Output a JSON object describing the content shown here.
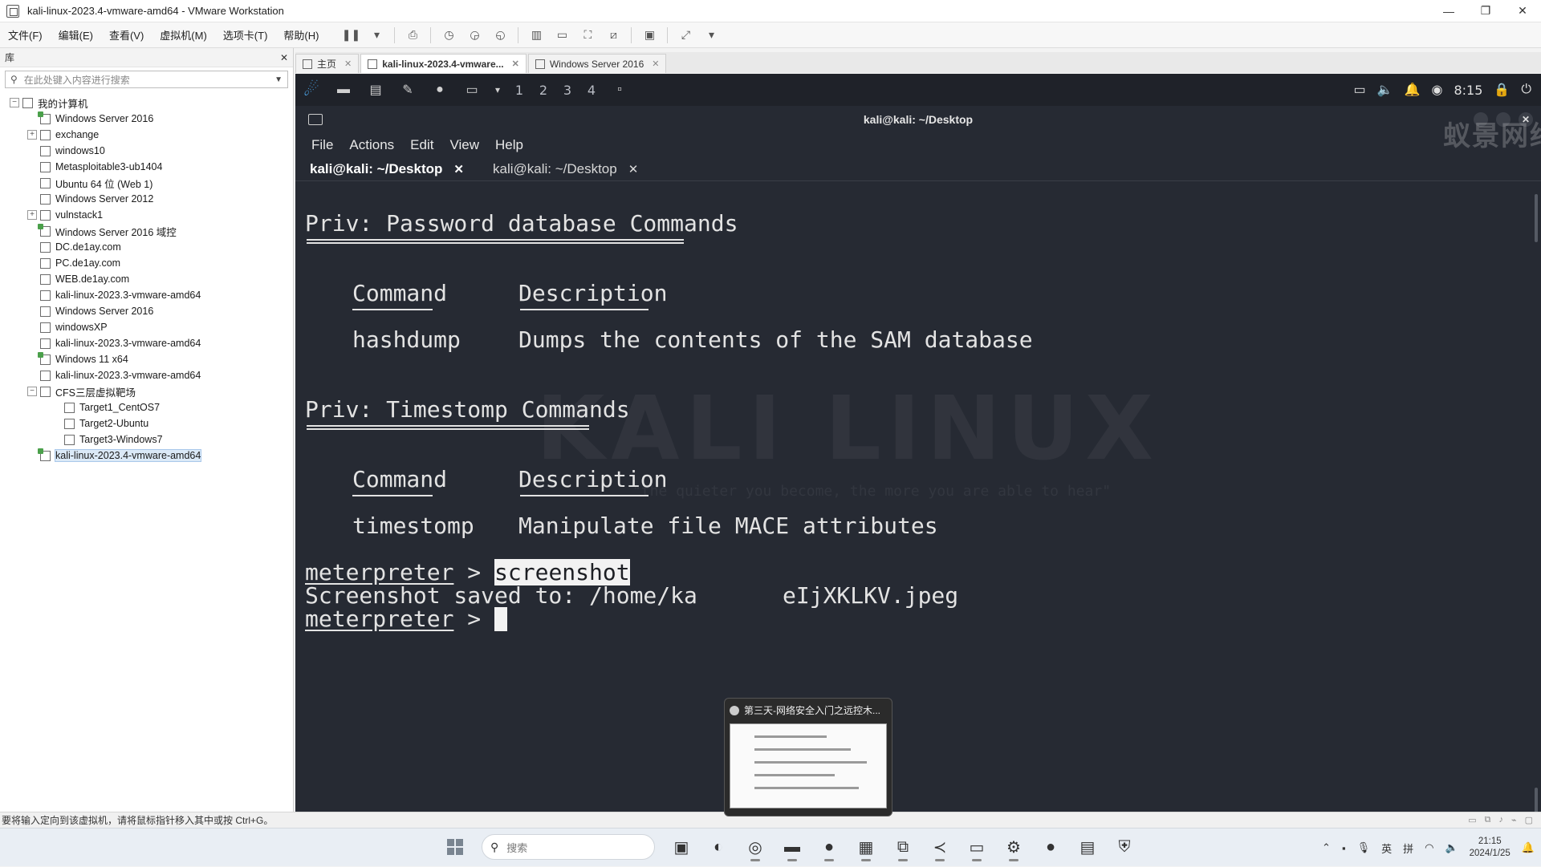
{
  "window": {
    "title": "kali-linux-2023.4-vmware-amd64 - VMware Workstation",
    "minimize": "—",
    "maximize": "❐",
    "close": "✕"
  },
  "menu": [
    "文件(F)",
    "编辑(E)",
    "查看(V)",
    "虚拟机(M)",
    "选项卡(T)",
    "帮助(H)"
  ],
  "library": {
    "title": "库",
    "close": "✕",
    "search_placeholder": "在此处键入内容进行搜索",
    "root": "我的计算机",
    "items": [
      {
        "label": "Windows Server 2016",
        "level": 1,
        "expander": "",
        "on": true
      },
      {
        "label": "exchange",
        "level": 1,
        "expander": "+",
        "on": false
      },
      {
        "label": "windows10",
        "level": 1,
        "expander": "",
        "on": false
      },
      {
        "label": "Metasploitable3-ub1404",
        "level": 1,
        "expander": "",
        "on": false
      },
      {
        "label": "Ubuntu 64 位 (Web 1)",
        "level": 1,
        "expander": "",
        "on": false
      },
      {
        "label": "Windows Server 2012",
        "level": 1,
        "expander": "",
        "on": false
      },
      {
        "label": "vulnstack1",
        "level": 1,
        "expander": "+",
        "on": false
      },
      {
        "label": "Windows Server 2016 域控",
        "level": 1,
        "expander": "",
        "on": true
      },
      {
        "label": "DC.de1ay.com",
        "level": 1,
        "expander": "",
        "on": false
      },
      {
        "label": "PC.de1ay.com",
        "level": 1,
        "expander": "",
        "on": false
      },
      {
        "label": "WEB.de1ay.com",
        "level": 1,
        "expander": "",
        "on": false
      },
      {
        "label": "kali-linux-2023.3-vmware-amd64",
        "level": 1,
        "expander": "",
        "on": false
      },
      {
        "label": "Windows Server 2016",
        "level": 1,
        "expander": "",
        "on": false
      },
      {
        "label": "windowsXP",
        "level": 1,
        "expander": "",
        "on": false
      },
      {
        "label": "kali-linux-2023.3-vmware-amd64",
        "level": 1,
        "expander": "",
        "on": false
      },
      {
        "label": "Windows 11 x64",
        "level": 1,
        "expander": "",
        "on": true
      },
      {
        "label": "kali-linux-2023.3-vmware-amd64",
        "level": 1,
        "expander": "",
        "on": false
      },
      {
        "label": "CFS三层虚拟靶场",
        "level": 1,
        "expander": "−",
        "on": false
      },
      {
        "label": "Target1_CentOS7",
        "level": 2,
        "expander": "",
        "on": false
      },
      {
        "label": "Target2-Ubuntu",
        "level": 2,
        "expander": "",
        "on": false
      },
      {
        "label": "Target3-Windows7",
        "level": 2,
        "expander": "",
        "on": false
      },
      {
        "label": "kali-linux-2023.4-vmware-amd64",
        "level": 1,
        "expander": "",
        "on": true,
        "selected": true
      }
    ]
  },
  "vm_tabs": [
    {
      "label": "主页",
      "active": false
    },
    {
      "label": "kali-linux-2023.4-vmware...",
      "active": true
    },
    {
      "label": "Windows Server 2016",
      "active": false
    }
  ],
  "xfce": {
    "workspaces": [
      "1",
      "2",
      "3",
      "4"
    ],
    "clock": "8:15"
  },
  "terminal": {
    "title": "kali@kali: ~/Desktop",
    "menu": [
      "File",
      "Actions",
      "Edit",
      "View",
      "Help"
    ],
    "tabs": [
      {
        "label": "kali@kali: ~/Desktop",
        "active": true
      },
      {
        "label": "kali@kali: ~/Desktop",
        "active": false
      }
    ],
    "section1_title": "Priv: Password database Commands",
    "section2_title": "Priv: Timestomp Commands",
    "col_command": "Command",
    "col_description": "Description",
    "row1_cmd": "hashdump",
    "row1_desc": "Dumps the contents of the SAM database",
    "row2_cmd": "timestomp",
    "row2_desc": "Manipulate file MACE attributes",
    "prompt": "meterpreter",
    "prompt_sep": " > ",
    "typed_command": "screenshot",
    "output_start": "Screenshot saved to: /home/ka",
    "output_end": "eIjXKLKV.jpeg",
    "watermark": "KALI LINUX",
    "watermark_sub": "\"the quieter you become, the more you are able to hear\""
  },
  "brand_watermark": "蚁景网络安全教学",
  "preview": {
    "title": "第三天-网络安全入门之远控木..."
  },
  "statusbar": {
    "text": "要将输入定向到该虚拟机，请将鼠标指针移入其中或按 Ctrl+G。"
  },
  "taskbar": {
    "search_placeholder": "搜索",
    "ime_lang": "英",
    "ime_mode": "拼",
    "time": "21:15",
    "date": "2024/1/25"
  }
}
